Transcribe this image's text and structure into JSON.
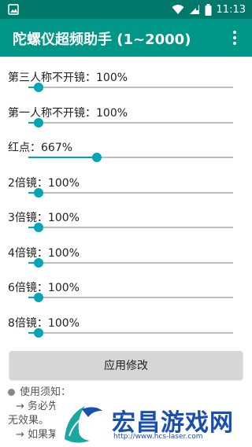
{
  "status_bar": {
    "time": "11:13",
    "icons": [
      "image-icon",
      "wifi-icon",
      "signal-icon",
      "battery-icon"
    ]
  },
  "app_bar": {
    "title": "陀螺仪超频助手 (1~2000)",
    "menu_icon": "overflow-menu-icon"
  },
  "settings": [
    {
      "label": "第三人称不开镜：100%",
      "level": 0.05
    },
    {
      "label": "第一人称不开镜：100%",
      "level": 0.05
    },
    {
      "label": "红点：667%",
      "level": 0.335
    },
    {
      "label": "2倍镜：100%",
      "level": 0.05
    },
    {
      "label": "3倍镜：100%",
      "level": 0.05
    },
    {
      "label": "4倍镜：100%",
      "level": 0.05
    },
    {
      "label": "6倍镜：100%",
      "level": 0.05
    },
    {
      "label": "8倍镜：100%",
      "level": 0.05
    }
  ],
  "apply_button": {
    "label": "应用修改"
  },
  "notice": {
    "title": "使用须知：",
    "line1": "→ 务必先",
    "line2": "无效果。",
    "line3": "→ 如果某"
  },
  "watermark": {
    "brand": "宏昌游戏网",
    "url": "http://www.hcs-laser.com"
  },
  "colors": {
    "status_bar": "#00796b",
    "app_bar": "#009688",
    "accent": "#00a6b5",
    "button": "#d6d6d6",
    "brand": "#1a4fae"
  }
}
